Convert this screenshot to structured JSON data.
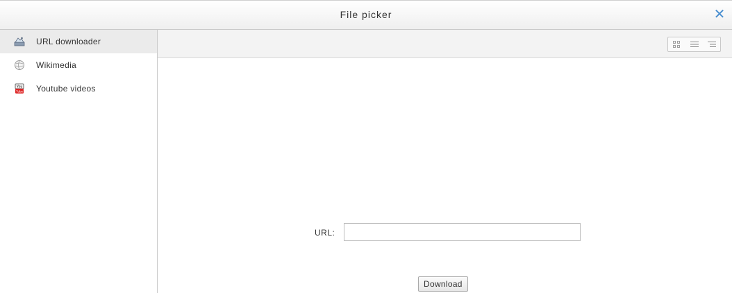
{
  "dialog": {
    "title": "File picker",
    "close_icon": "close-icon"
  },
  "sidebar": {
    "items": [
      {
        "label": "URL downloader",
        "icon": "url-downloader-icon",
        "selected": true
      },
      {
        "label": "Wikimedia",
        "icon": "wikimedia-icon",
        "selected": false
      },
      {
        "label": "Youtube videos",
        "icon": "youtube-icon",
        "selected": false
      }
    ]
  },
  "toolbar": {
    "view_buttons": [
      "icon-view-icon",
      "list-view-icon",
      "tree-view-icon"
    ]
  },
  "form": {
    "url_label": "URL:",
    "url_value": "",
    "download_label": "Download"
  },
  "colors": {
    "accent": "#4a8fd0",
    "selected_bg": "#ebebeb"
  }
}
